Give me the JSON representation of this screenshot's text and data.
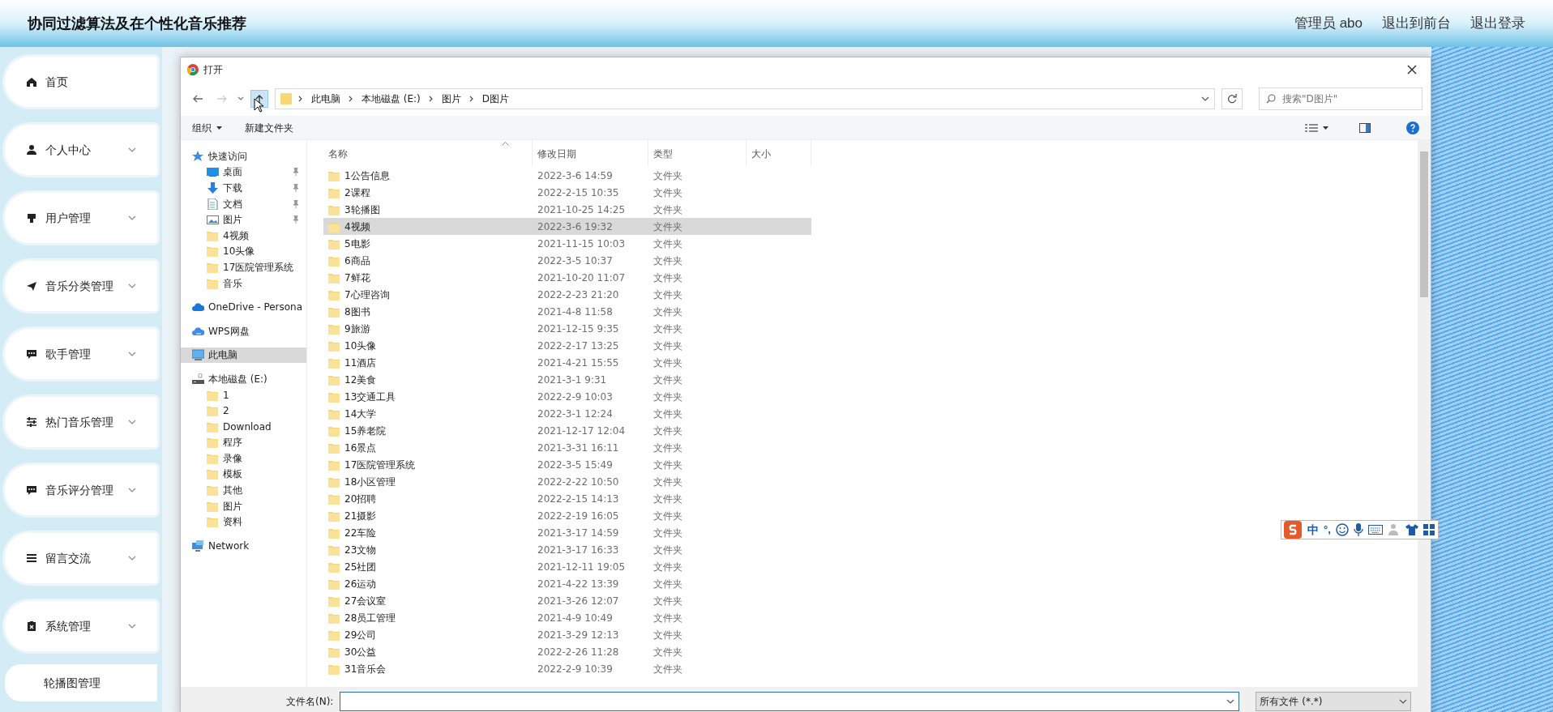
{
  "header": {
    "title": "协同过滤算法及在个性化音乐推荐",
    "links": [
      "管理员 abo",
      "退出到前台",
      "退出登录"
    ]
  },
  "sidebar": {
    "items": [
      {
        "label": "首页",
        "kind": "home",
        "expandable": false
      },
      {
        "label": "个人中心",
        "kind": "person",
        "expandable": true
      },
      {
        "label": "用户管理",
        "kind": "card",
        "expandable": true
      },
      {
        "label": "音乐分类管理",
        "kind": "plane",
        "expandable": true
      },
      {
        "label": "歌手管理",
        "kind": "message",
        "expandable": true
      },
      {
        "label": "热门音乐管理",
        "kind": "sliders",
        "expandable": true
      },
      {
        "label": "音乐评分管理",
        "kind": "message",
        "expandable": true
      },
      {
        "label": "留言交流",
        "kind": "list",
        "expandable": true
      },
      {
        "label": "系统管理",
        "kind": "clipboard",
        "expandable": true
      }
    ],
    "sub_items": [
      "轮播图管理"
    ]
  },
  "dialog": {
    "title": "打开",
    "breadcrumb": [
      "此电脑",
      "本地磁盘 (E:)",
      "图片",
      "D图片"
    ],
    "search": {
      "placeholder": "搜索\"D图片\""
    },
    "toolbar": [
      "组织",
      "新建文件夹"
    ],
    "nav": [
      {
        "label": "快速访问",
        "kind": "star",
        "selected": false,
        "children": [
          {
            "label": "桌面",
            "kind": "desktop",
            "pinned": true,
            "selected": false
          },
          {
            "label": "下载",
            "kind": "download",
            "pinned": true,
            "selected": false
          },
          {
            "label": "文档",
            "kind": "document",
            "pinned": true,
            "selected": false
          },
          {
            "label": "图片",
            "kind": "picture",
            "pinned": true,
            "selected": false
          },
          {
            "label": "4视频",
            "kind": "folder",
            "pinned": false,
            "selected": false
          },
          {
            "label": "10头像",
            "kind": "folder",
            "pinned": false,
            "selected": false
          },
          {
            "label": "17医院管理系统",
            "kind": "folder",
            "pinned": false,
            "selected": false
          },
          {
            "label": "音乐",
            "kind": "folder",
            "pinned": false,
            "selected": false
          }
        ]
      },
      {
        "label": "OneDrive - Persona",
        "kind": "cloud",
        "selected": false
      },
      {
        "label": "WPS网盘",
        "kind": "wps",
        "selected": false
      },
      {
        "label": "此电脑",
        "kind": "pc",
        "selected": true
      },
      {
        "label": "本地磁盘 (E:)",
        "kind": "drive",
        "selected": false,
        "children": [
          {
            "label": "1",
            "kind": "folder",
            "pinned": false,
            "selected": false
          },
          {
            "label": "2",
            "kind": "folder",
            "pinned": false,
            "selected": false
          },
          {
            "label": "Download",
            "kind": "folder",
            "pinned": false,
            "selected": false
          },
          {
            "label": "程序",
            "kind": "folder",
            "pinned": false,
            "selected": false
          },
          {
            "label": "录像",
            "kind": "folder",
            "pinned": false,
            "selected": false
          },
          {
            "label": "模板",
            "kind": "folder",
            "pinned": false,
            "selected": false
          },
          {
            "label": "其他",
            "kind": "folder",
            "pinned": false,
            "selected": false
          },
          {
            "label": "图片",
            "kind": "folder",
            "pinned": false,
            "selected": false
          },
          {
            "label": "资料",
            "kind": "folder",
            "pinned": false,
            "selected": false
          }
        ]
      },
      {
        "label": "Network",
        "kind": "network",
        "selected": false
      }
    ],
    "columns": [
      "名称",
      "修改日期",
      "类型",
      "大小"
    ],
    "rows": [
      {
        "name": "1公告信息",
        "date": "2022-3-6 14:59",
        "type": "文件夹",
        "selected": false
      },
      {
        "name": "2课程",
        "date": "2022-2-15 10:35",
        "type": "文件夹",
        "selected": false
      },
      {
        "name": "3轮播图",
        "date": "2021-10-25 14:25",
        "type": "文件夹",
        "selected": false
      },
      {
        "name": "4视频",
        "date": "2022-3-6 19:32",
        "type": "文件夹",
        "selected": true
      },
      {
        "name": "5电影",
        "date": "2021-11-15 10:03",
        "type": "文件夹",
        "selected": false
      },
      {
        "name": "6商品",
        "date": "2022-3-5 10:37",
        "type": "文件夹",
        "selected": false
      },
      {
        "name": "7鲜花",
        "date": "2021-10-20 11:07",
        "type": "文件夹",
        "selected": false
      },
      {
        "name": "7心理咨询",
        "date": "2022-2-23 21:20",
        "type": "文件夹",
        "selected": false
      },
      {
        "name": "8图书",
        "date": "2021-4-8 11:58",
        "type": "文件夹",
        "selected": false
      },
      {
        "name": "9旅游",
        "date": "2021-12-15 9:35",
        "type": "文件夹",
        "selected": false
      },
      {
        "name": "10头像",
        "date": "2022-2-17 13:25",
        "type": "文件夹",
        "selected": false
      },
      {
        "name": "11酒店",
        "date": "2021-4-21 15:55",
        "type": "文件夹",
        "selected": false
      },
      {
        "name": "12美食",
        "date": "2021-3-1 9:31",
        "type": "文件夹",
        "selected": false
      },
      {
        "name": "13交通工具",
        "date": "2022-2-9 10:03",
        "type": "文件夹",
        "selected": false
      },
      {
        "name": "14大学",
        "date": "2022-3-1 12:24",
        "type": "文件夹",
        "selected": false
      },
      {
        "name": "15养老院",
        "date": "2021-12-17 12:04",
        "type": "文件夹",
        "selected": false
      },
      {
        "name": "16景点",
        "date": "2021-3-31 16:11",
        "type": "文件夹",
        "selected": false
      },
      {
        "name": "17医院管理系统",
        "date": "2022-3-5 15:49",
        "type": "文件夹",
        "selected": false
      },
      {
        "name": "18小区管理",
        "date": "2022-2-22 10:50",
        "type": "文件夹",
        "selected": false
      },
      {
        "name": "20招聘",
        "date": "2022-2-15 14:13",
        "type": "文件夹",
        "selected": false
      },
      {
        "name": "21摄影",
        "date": "2022-2-19 16:05",
        "type": "文件夹",
        "selected": false
      },
      {
        "name": "22车险",
        "date": "2021-3-17 14:59",
        "type": "文件夹",
        "selected": false
      },
      {
        "name": "23文物",
        "date": "2021-3-17 16:33",
        "type": "文件夹",
        "selected": false
      },
      {
        "name": "25社团",
        "date": "2021-12-11 19:05",
        "type": "文件夹",
        "selected": false
      },
      {
        "name": "26运动",
        "date": "2021-4-22 13:39",
        "type": "文件夹",
        "selected": false
      },
      {
        "name": "27会议室",
        "date": "2021-3-26 12:07",
        "type": "文件夹",
        "selected": false
      },
      {
        "name": "28员工管理",
        "date": "2021-4-9 10:49",
        "type": "文件夹",
        "selected": false
      },
      {
        "name": "29公司",
        "date": "2021-3-29 12:13",
        "type": "文件夹",
        "selected": false
      },
      {
        "name": "30公益",
        "date": "2022-2-26 11:28",
        "type": "文件夹",
        "selected": false
      },
      {
        "name": "31音乐会",
        "date": "2022-2-9 10:39",
        "type": "文件夹",
        "selected": false
      }
    ],
    "filename_label": "文件名(N):",
    "file_type": "所有文件 (*.*)"
  },
  "ime_toolbar": {
    "mode": "中",
    "punctuation": "°,"
  }
}
